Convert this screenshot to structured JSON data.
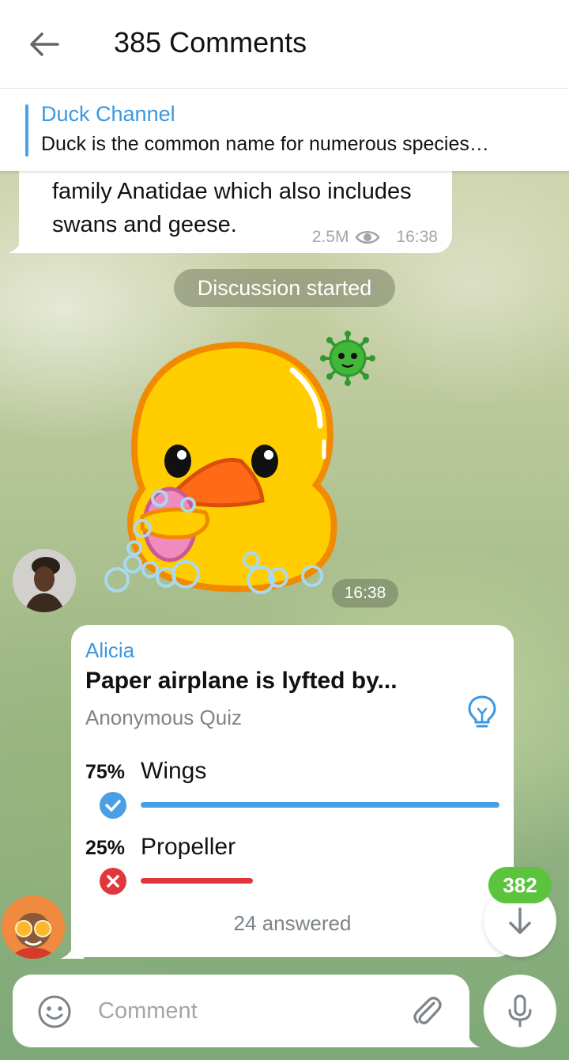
{
  "header": {
    "title": "385 Comments",
    "back_icon": "arrow-left-icon"
  },
  "pinned": {
    "name": "Duck Channel",
    "text": "Duck is the common name for numerous species…"
  },
  "post": {
    "lines": [
      "family Anatidae which also includes",
      "swans and geese."
    ],
    "views": "2.5M",
    "views_icon": "eye-icon",
    "time": "16:38"
  },
  "service_message": "Discussion started",
  "sticker": {
    "time": "16:38",
    "description_icon": "duck-sticker"
  },
  "quiz": {
    "author": "Alicia",
    "question": "Paper airplane is lyfted by...",
    "type": "Anonymous Quiz",
    "options": [
      {
        "percent": "75%",
        "label": "Wings",
        "share": 0.75,
        "correct": true,
        "color": "#4a9ee3"
      },
      {
        "percent": "25%",
        "label": "Propeller",
        "share": 0.25,
        "correct": false,
        "color": "#e0363c"
      }
    ],
    "answered": "24 answered"
  },
  "scroll_down": {
    "unread_count": "382",
    "badge_color": "#5cc43c"
  },
  "composer": {
    "placeholder": "Comment",
    "value": ""
  },
  "colors": {
    "accent": "#3b97df",
    "correct": "#4a9ee3",
    "wrong": "#e0363c"
  }
}
